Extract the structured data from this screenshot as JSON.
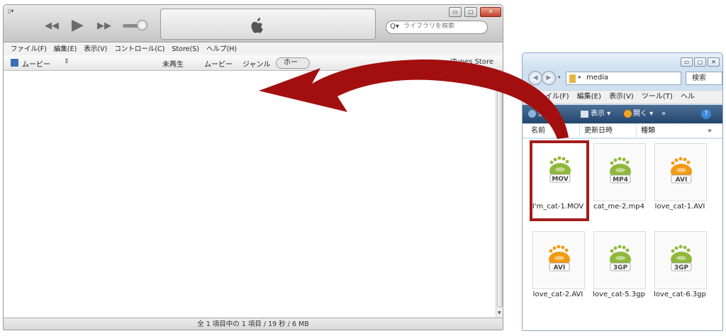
{
  "itunes": {
    "toolbar": {
      "menu_icon": "▯▾",
      "search_placeholder": "ライブラリを検索"
    },
    "menubar": [
      "ファイル(F)",
      "編集(E)",
      "表示(V)",
      "コントロール(C)",
      "Store(S)",
      "ヘルプ(H)"
    ],
    "library_select": "ムービー",
    "tabs": [
      "未再生",
      "ムービー",
      "ジャンル"
    ],
    "home_tab": "ホー",
    "store_link": "iTunes Store",
    "status": "全 1 項目中の 1 項目 / 19 秒 / 6 MB"
  },
  "explorer": {
    "path": "media",
    "search_label": "検索",
    "menubar": [
      "ファイル(F)",
      "編集(E)",
      "表示(V)",
      "ツール(T)",
      "ヘル"
    ],
    "toolbar": {
      "organize": "整理 ▾",
      "view": "表示 ▾",
      "open": "開く ▾",
      "more": "»"
    },
    "columns": [
      "名前",
      "更新日時",
      "種類",
      "»"
    ],
    "files": [
      {
        "name": "I'm_cat-1.MOV",
        "badge": "MOV",
        "color": "#8fb83a"
      },
      {
        "name": "cat_me-2.mp4",
        "badge": "MP4",
        "color": "#8fb83a"
      },
      {
        "name": "love_cat-1.AVI",
        "badge": "AVI",
        "color": "#f29b12"
      },
      {
        "name": "love_cat-2.AVI",
        "badge": "AVI",
        "color": "#f29b12"
      },
      {
        "name": "love_cat-5.3gp",
        "badge": "3GP",
        "color": "#8fb83a"
      },
      {
        "name": "love_cat-6.3gp",
        "badge": "3GP",
        "color": "#8fb83a"
      }
    ]
  },
  "colors": {
    "arrow": "#a30f0f",
    "selection_frame": "#a41c1c"
  }
}
